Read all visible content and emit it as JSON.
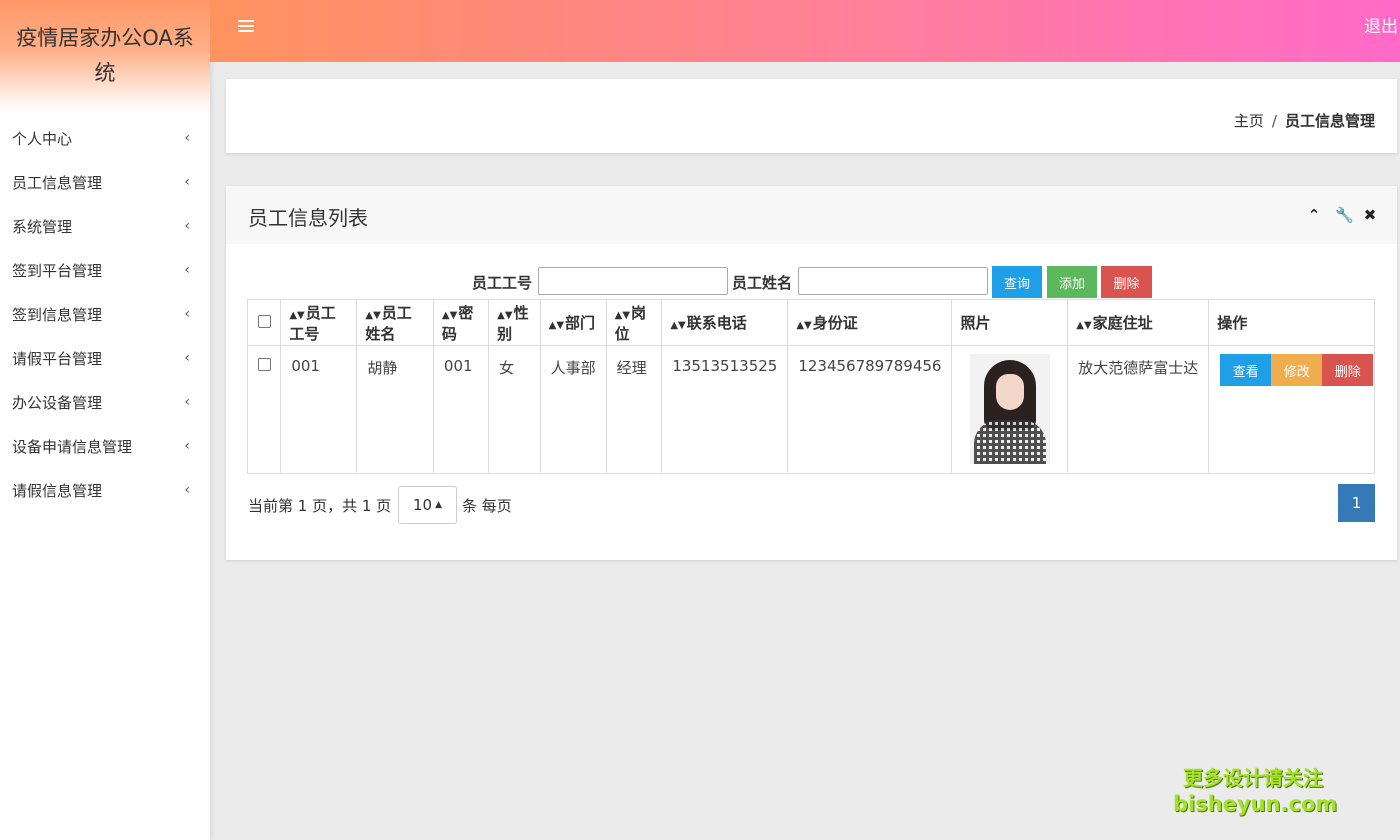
{
  "app": {
    "title": "疫情居家办公OA系统",
    "logout_label": "退出"
  },
  "sidebar": {
    "items": [
      {
        "label": "个人中心"
      },
      {
        "label": "员工信息管理"
      },
      {
        "label": "系统管理"
      },
      {
        "label": "签到平台管理"
      },
      {
        "label": "签到信息管理"
      },
      {
        "label": "请假平台管理"
      },
      {
        "label": "办公设备管理"
      },
      {
        "label": "设备申请信息管理"
      },
      {
        "label": "请假信息管理"
      }
    ]
  },
  "breadcrumb": {
    "home": "主页",
    "separator": "/",
    "current": "员工信息管理"
  },
  "panel": {
    "title": "员工信息列表"
  },
  "search": {
    "id_label": "员工工号",
    "name_label": "员工姓名",
    "id_value": "",
    "name_value": "",
    "query_label": "查询",
    "add_label": "添加",
    "delete_label": "删除"
  },
  "table": {
    "columns": [
      "员工工号",
      "员工姓名",
      "密码",
      "性别",
      "部门",
      "岗位",
      "联系电话",
      "身份证",
      "照片",
      "家庭住址",
      "操作"
    ],
    "rows": [
      {
        "id": "001",
        "name": "胡静",
        "password": "001",
        "gender": "女",
        "department": "人事部",
        "position": "经理",
        "phone": "13513513525",
        "id_card": "123456789789456",
        "address": "放大范德萨富士达",
        "view_label": "查看",
        "edit_label": "修改",
        "delete_label": "删除"
      }
    ]
  },
  "pagination": {
    "info": "当前第 1 页，共 1 页",
    "page_size": "10",
    "per_page_label": "条 每页",
    "current_page": "1"
  },
  "watermark": {
    "line1": "更多设计请关注",
    "line2": "bisheyun.com"
  },
  "colors": {
    "header_start": "#ff935e",
    "header_end": "#ff6ac7",
    "primary": "#1f9fe8",
    "success": "#5cb85c",
    "danger": "#d9534f",
    "warning": "#f0ad4e",
    "page_active": "#337ab7"
  }
}
